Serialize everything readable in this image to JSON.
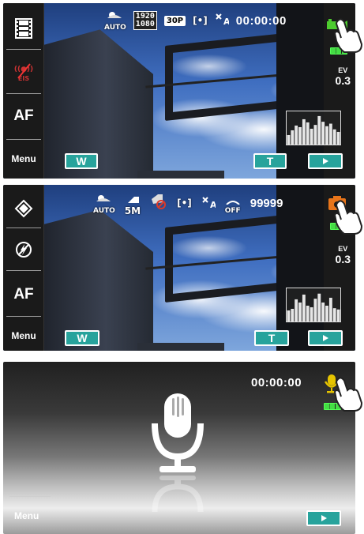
{
  "screen_video": {
    "mode_label": "AUTO",
    "resolution": [
      "1920",
      "1080"
    ],
    "fps": "30P",
    "metering_icon": "[•]",
    "timecode": "00:00:00",
    "af_label": "AF",
    "menu_label": "Menu",
    "ev_label": "EV",
    "ev_value": "0.3",
    "wide_label": "W",
    "tele_label": "T",
    "battery_level": 1.0,
    "histogram": [
      30,
      45,
      60,
      55,
      80,
      70,
      50,
      62,
      90,
      72,
      58,
      66,
      48,
      40
    ]
  },
  "screen_photo": {
    "mode_label": "AUTO",
    "size_label": "5M",
    "metering_icon": "[•]",
    "off_label": "OFF",
    "counter": "99999",
    "af_label": "AF",
    "menu_label": "Menu",
    "ev_label": "EV",
    "ev_value": "0.3",
    "wide_label": "W",
    "tele_label": "T",
    "battery_level": 1.0,
    "histogram": [
      35,
      40,
      70,
      60,
      85,
      50,
      45,
      72,
      88,
      60,
      50,
      75,
      42,
      38
    ]
  },
  "screen_voice": {
    "timecode": "00:00:00",
    "menu_label": "Menu",
    "battery_level": 1.0
  },
  "colors": {
    "accent_teal": "#27a39c",
    "video_green": "#4dcc2f",
    "camera_orange": "#e8751a",
    "mic_yellow": "#e6c400",
    "flag_red": "#d93a2b"
  },
  "icons": {
    "video": "film-strip-icon",
    "photo": "camera-icon",
    "voice": "microphone-icon"
  }
}
